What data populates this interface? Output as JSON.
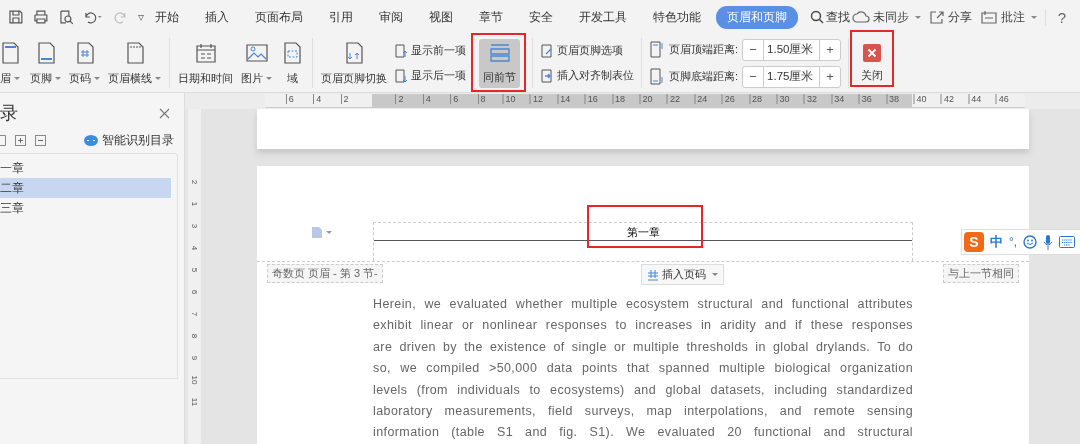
{
  "quick_access": {
    "more": "▿"
  },
  "menu_tabs": [
    {
      "label": "开始",
      "selected": false
    },
    {
      "label": "插入",
      "selected": false
    },
    {
      "label": "页面布局",
      "selected": false
    },
    {
      "label": "引用",
      "selected": false
    },
    {
      "label": "审阅",
      "selected": false
    },
    {
      "label": "视图",
      "selected": false
    },
    {
      "label": "章节",
      "selected": false
    },
    {
      "label": "安全",
      "selected": false
    },
    {
      "label": "开发工具",
      "selected": false
    },
    {
      "label": "特色功能",
      "selected": false
    },
    {
      "label": "页眉和页脚",
      "selected": true
    }
  ],
  "search": {
    "label": "查找"
  },
  "top_right": [
    {
      "kind": "sync",
      "label": "未同步"
    },
    {
      "kind": "share",
      "label": "分享"
    },
    {
      "kind": "comment",
      "label": "批注"
    },
    {
      "kind": "help",
      "label": "?"
    }
  ],
  "ribbon": {
    "big_buttons": [
      {
        "kind": "header",
        "label": "眉",
        "dropdown": true
      },
      {
        "kind": "footer",
        "label": "页脚",
        "dropdown": true
      },
      {
        "kind": "pagenum",
        "label": "页码",
        "dropdown": true
      },
      {
        "kind": "rule",
        "label": "页眉横线",
        "dropdown": true
      },
      {
        "kind": "sep"
      },
      {
        "kind": "calendar",
        "label": "日期和时间",
        "dropdown": false
      },
      {
        "kind": "image",
        "label": "图片",
        "dropdown": true
      },
      {
        "kind": "field",
        "label": "域",
        "dropdown": false
      },
      {
        "kind": "sep"
      },
      {
        "kind": "switch",
        "label": "页眉页脚切换",
        "dropdown": false
      }
    ],
    "nav_buttons": [
      {
        "kind": "prev",
        "label": "显示前一项"
      },
      {
        "kind": "next",
        "label": "显示后一项"
      }
    ],
    "same_as_previous": {
      "label": "同前节",
      "on": true
    },
    "option_buttons": [
      {
        "kind": "options",
        "label": "页眉页脚选项"
      },
      {
        "kind": "tab",
        "label": "插入对齐制表位"
      }
    ],
    "distances": [
      {
        "kind": "top",
        "label": "页眉顶端距离:",
        "value": "1.50厘米",
        "minus": "−",
        "plus": "+"
      },
      {
        "kind": "bottom",
        "label": "页脚底端距离:",
        "value": "1.75厘米",
        "minus": "−",
        "plus": "+"
      }
    ],
    "close": {
      "label": "关闭"
    }
  },
  "toc_panel": {
    "title": "录",
    "smart_button": "智能识别目录",
    "items": [
      {
        "label": "一章",
        "selected": false
      },
      {
        "label": "二章",
        "selected": true
      },
      {
        "label": "三章",
        "selected": false
      }
    ]
  },
  "ruler": {
    "left_labels": [
      "6",
      "4",
      "2"
    ],
    "right_labels": [
      "2",
      "4",
      "6",
      "8",
      "10",
      "12",
      "14",
      "16",
      "18",
      "20",
      "22",
      "24",
      "26",
      "28",
      "30",
      "32",
      "34",
      "36",
      "38",
      "40",
      "42",
      "44",
      "46"
    ],
    "vertical_labels": [
      "2",
      "1",
      "3",
      "4",
      "5",
      "6",
      "7",
      "8",
      "9",
      "10",
      "11"
    ]
  },
  "header": {
    "text": "第一章",
    "section_tag": "奇数页 页眉  - 第 3 节-",
    "insert_page_number": "插入页码",
    "link_tag": "与上一节相同"
  },
  "body_lines": [
    "Herein, we evaluated whether multiple ecosystem structural and functional attributes",
    "exhibit linear or nonlinear responses to increases in aridity and if these responses",
    "are driven by the existence of single or multiple thresholds in global drylands. To do",
    "so, we compiled >50,000 data points that spanned multiple biological organization",
    "levels (from individuals to ecosystems) and global datasets, including standardized",
    "laboratory measurements, field surveys, map interpolations, and remote sensing",
    "information (table S1 and fig. S1). We evaluated 20 functional and structural"
  ],
  "ime_bar": {
    "logo": "S",
    "mode": "中",
    "punct": "°,"
  }
}
